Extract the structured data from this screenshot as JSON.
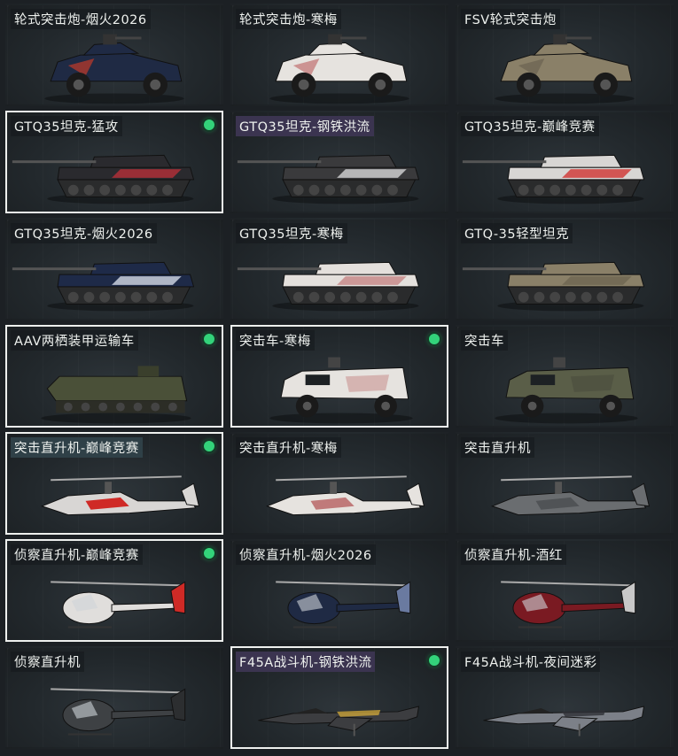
{
  "vehicles": [
    {
      "name": "轮式突击炮-烟火2026",
      "type": "wheeled",
      "color": "#1f2a44",
      "accent": "#c23a2a",
      "selected": false,
      "equipped": false
    },
    {
      "name": "轮式突击炮-寒梅",
      "type": "wheeled",
      "color": "#e6e3df",
      "accent": "#c07070",
      "selected": false,
      "equipped": false
    },
    {
      "name": "FSV轮式突击炮",
      "type": "wheeled",
      "color": "#8a8068",
      "accent": "#6b6351",
      "selected": false,
      "equipped": false
    },
    {
      "name": "GTQ35坦克-猛攻",
      "type": "tank",
      "color": "#2a2a2e",
      "accent": "#c0303a",
      "selected": true,
      "equipped": true
    },
    {
      "name": "GTQ35坦克-钢铁洪流",
      "type": "tank",
      "color": "#3a3a3c",
      "accent": "#e0e0e0",
      "selected": false,
      "equipped": false,
      "tag": "purple"
    },
    {
      "name": "GTQ35坦克-巅峰竞赛",
      "type": "tank",
      "color": "#d8d6d4",
      "accent": "#d02a28",
      "selected": false,
      "equipped": false
    },
    {
      "name": "GTQ35坦克-烟火2026",
      "type": "tank",
      "color": "#1e2a48",
      "accent": "#e0e6f0",
      "selected": false,
      "equipped": false
    },
    {
      "name": "GTQ35坦克-寒梅",
      "type": "tank",
      "color": "#e4e0dc",
      "accent": "#c48080",
      "selected": false,
      "equipped": false
    },
    {
      "name": "GTQ-35轻型坦克",
      "type": "tank",
      "color": "#8a8068",
      "accent": "#6c6450",
      "selected": false,
      "equipped": false
    },
    {
      "name": "AAV两栖装甲运输车",
      "type": "aav",
      "color": "#4a5038",
      "accent": "#3a3f2c",
      "selected": false,
      "equipped": true,
      "hl": true
    },
    {
      "name": "突击车-寒梅",
      "type": "truck",
      "color": "#e6e3df",
      "accent": "#c07a7a",
      "selected": true,
      "equipped": true
    },
    {
      "name": "突击车",
      "type": "truck",
      "color": "#5a5e48",
      "accent": "#44473a",
      "selected": false,
      "equipped": false
    },
    {
      "name": "突击直升机-巅峰竞赛",
      "type": "heli",
      "color": "#d8d6d4",
      "accent": "#cf2a26",
      "selected": true,
      "equipped": true,
      "tag": "teal"
    },
    {
      "name": "突击直升机-寒梅",
      "type": "heli",
      "color": "#e6e3df",
      "accent": "#c07a7a",
      "selected": false,
      "equipped": false
    },
    {
      "name": "突击直升机",
      "type": "heli",
      "color": "#6a6d70",
      "accent": "#505356",
      "selected": false,
      "equipped": false
    },
    {
      "name": "侦察直升机-巅峰竞赛",
      "type": "scout",
      "color": "#e0dedc",
      "accent": "#cf2a26",
      "selected": true,
      "equipped": true
    },
    {
      "name": "侦察直升机-烟火2026",
      "type": "scout",
      "color": "#1f2a44",
      "accent": "#6a7aa0",
      "selected": false,
      "equipped": false
    },
    {
      "name": "侦察直升机-酒红",
      "type": "scout",
      "color": "#7a1a22",
      "accent": "#c8c8c8",
      "selected": false,
      "equipped": false
    },
    {
      "name": "侦察直升机",
      "type": "scout",
      "color": "#3e4144",
      "accent": "#2c2e30",
      "selected": false,
      "equipped": false
    },
    {
      "name": "F45A战斗机-钢铁洪流",
      "type": "jet",
      "color": "#3c3d40",
      "accent": "#c9a23a",
      "selected": true,
      "equipped": true,
      "tag": "purple"
    },
    {
      "name": "F45A战斗机-夜间迷彩",
      "type": "jet",
      "color": "#7c8088",
      "accent": "#2e3036",
      "selected": false,
      "equipped": false
    }
  ]
}
